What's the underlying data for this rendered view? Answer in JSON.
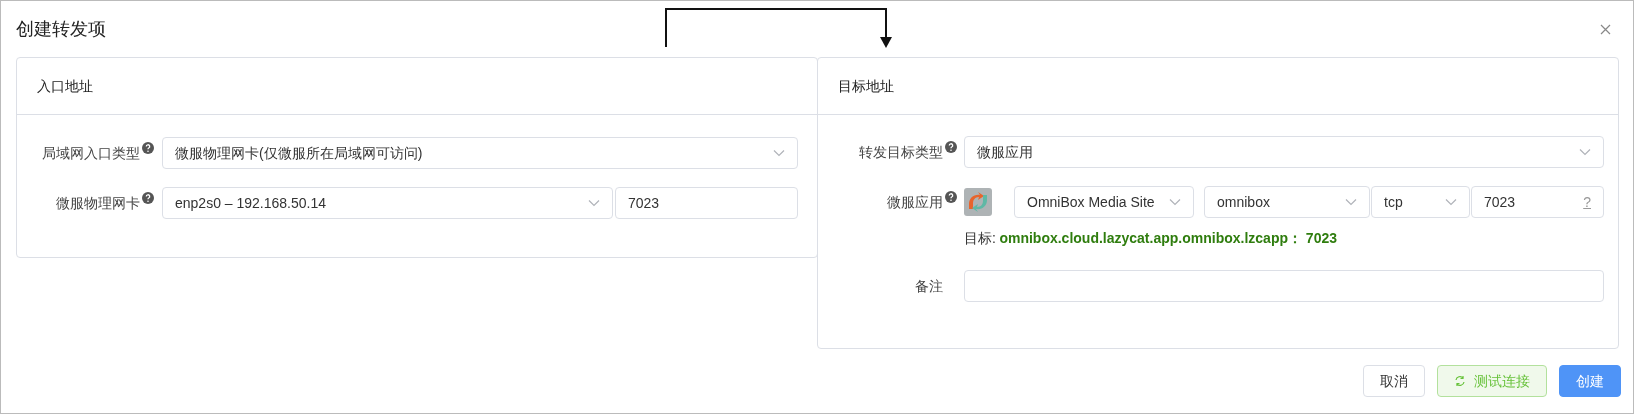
{
  "dialog": {
    "title": "创建转发项"
  },
  "entry": {
    "header": "入口地址",
    "fields": [
      {
        "kind": "select",
        "label": "局域网入口类型",
        "value": "微服物理网卡(仅微服所在局域网可访问)"
      },
      {
        "kind": "select-port",
        "label": "微服物理网卡",
        "value": "enp2s0 – 192.168.50.14",
        "port": "7023"
      }
    ]
  },
  "target": {
    "header": "目标地址",
    "type_label": "转发目标类型",
    "type_value": "微服应用",
    "app_label": "微服应用",
    "app_name": "OmniBox Media Site",
    "service": "omnibox",
    "protocol": "tcp",
    "port": "7023",
    "port_hint": "?",
    "target_label": "目标:",
    "target_value": "omnibox.cloud.lazycat.app.omnibox.lzcapp： 7023",
    "note_label": "备注"
  },
  "buttons": [
    {
      "kind": "default",
      "label": "取消"
    },
    {
      "kind": "test",
      "label": "测试连接"
    },
    {
      "kind": "primary",
      "label": "创建"
    }
  ]
}
